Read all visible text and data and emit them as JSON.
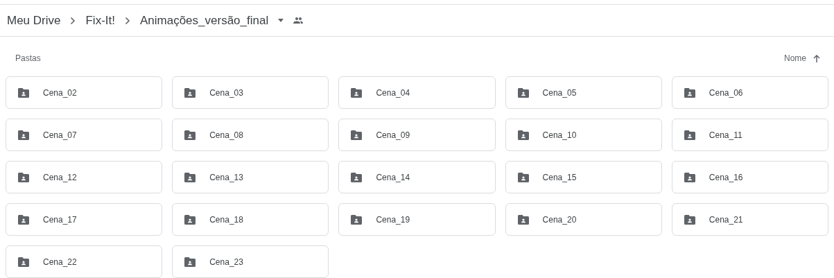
{
  "breadcrumb": [
    {
      "label": "Meu Drive"
    },
    {
      "label": "Fix-It!"
    },
    {
      "label": "Animações_versão_final"
    }
  ],
  "section_label": "Pastas",
  "sort": {
    "label": "Nome"
  },
  "folders": [
    {
      "name": "Cena_02"
    },
    {
      "name": "Cena_03"
    },
    {
      "name": "Cena_04"
    },
    {
      "name": "Cena_05"
    },
    {
      "name": "Cena_06"
    },
    {
      "name": "Cena_07"
    },
    {
      "name": "Cena_08"
    },
    {
      "name": "Cena_09"
    },
    {
      "name": "Cena_10"
    },
    {
      "name": "Cena_11"
    },
    {
      "name": "Cena_12"
    },
    {
      "name": "Cena_13"
    },
    {
      "name": "Cena_14"
    },
    {
      "name": "Cena_15"
    },
    {
      "name": "Cena_16"
    },
    {
      "name": "Cena_17"
    },
    {
      "name": "Cena_18"
    },
    {
      "name": "Cena_19"
    },
    {
      "name": "Cena_20"
    },
    {
      "name": "Cena_21"
    },
    {
      "name": "Cena_22"
    },
    {
      "name": "Cena_23"
    }
  ]
}
